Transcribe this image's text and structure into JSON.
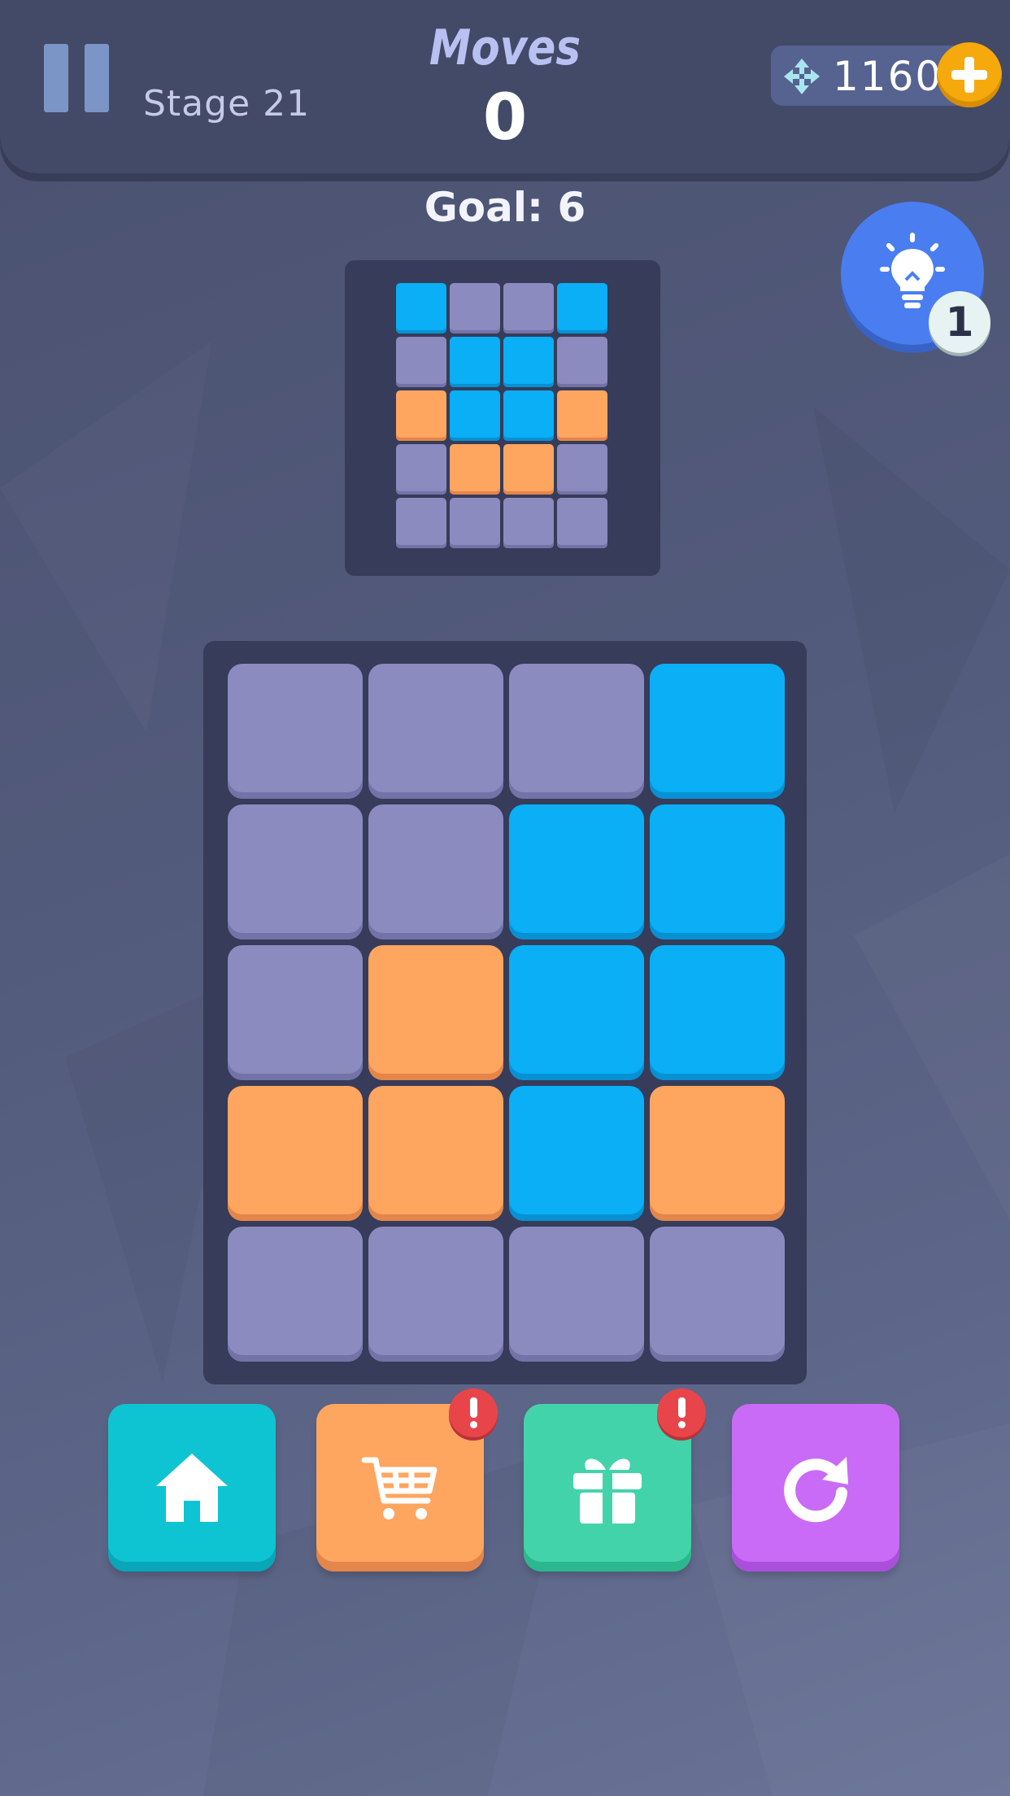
{
  "header": {
    "stage": "Stage 21",
    "moves_label": "Moves",
    "moves_value": "0",
    "currency_value": "1160"
  },
  "goal": "Goal: 6",
  "hint": {
    "count": "1"
  },
  "colors": {
    "gray": "#8b8bc0",
    "blue": "#0aaff5",
    "orange": "#fea560",
    "panel": "#363c59"
  },
  "target_pattern": [
    [
      "blue",
      "gray",
      "gray",
      "blue"
    ],
    [
      "gray",
      "blue",
      "blue",
      "gray"
    ],
    [
      "orange",
      "blue",
      "blue",
      "orange"
    ],
    [
      "gray",
      "orange",
      "orange",
      "gray"
    ],
    [
      "gray",
      "gray",
      "gray",
      "gray"
    ]
  ],
  "board": [
    [
      "gray",
      "gray",
      "gray",
      "blue"
    ],
    [
      "gray",
      "gray",
      "blue",
      "blue"
    ],
    [
      "gray",
      "orange",
      "blue",
      "blue"
    ],
    [
      "orange",
      "orange",
      "blue",
      "orange"
    ],
    [
      "gray",
      "gray",
      "gray",
      "gray"
    ]
  ],
  "bottom_buttons": [
    {
      "name": "home",
      "icon": "home-icon",
      "color": "#0ec4d2"
    },
    {
      "name": "shop",
      "icon": "cart-icon",
      "color": "#fea560",
      "alert": true
    },
    {
      "name": "gift",
      "icon": "gift-icon",
      "color": "#43d3ab",
      "alert": true
    },
    {
      "name": "restart",
      "icon": "restart-icon",
      "color": "#c96bf6"
    }
  ]
}
